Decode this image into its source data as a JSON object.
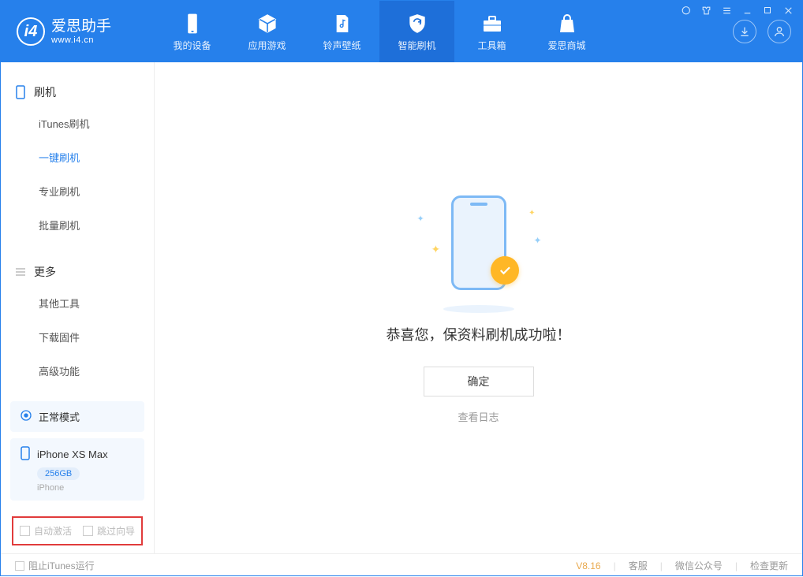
{
  "app": {
    "name": "爱思助手",
    "url": "www.i4.cn"
  },
  "nav": {
    "items": [
      {
        "label": "我的设备"
      },
      {
        "label": "应用游戏"
      },
      {
        "label": "铃声壁纸"
      },
      {
        "label": "智能刷机"
      },
      {
        "label": "工具箱"
      },
      {
        "label": "爱思商城"
      }
    ]
  },
  "sidebar": {
    "section1": {
      "title": "刷机",
      "items": [
        "iTunes刷机",
        "一键刷机",
        "专业刷机",
        "批量刷机"
      ]
    },
    "section2": {
      "title": "更多",
      "items": [
        "其他工具",
        "下载固件",
        "高级功能"
      ]
    },
    "status": "正常模式",
    "device": {
      "name": "iPhone XS Max",
      "storage": "256GB",
      "type": "iPhone"
    },
    "checks": {
      "auto_activate": "自动激活",
      "skip_guide": "跳过向导"
    }
  },
  "main": {
    "success": "恭喜您，保资料刷机成功啦！",
    "ok": "确定",
    "view_log": "查看日志"
  },
  "footer": {
    "block_itunes": "阻止iTunes运行",
    "version": "V8.16",
    "links": [
      "客服",
      "微信公众号",
      "检查更新"
    ]
  }
}
